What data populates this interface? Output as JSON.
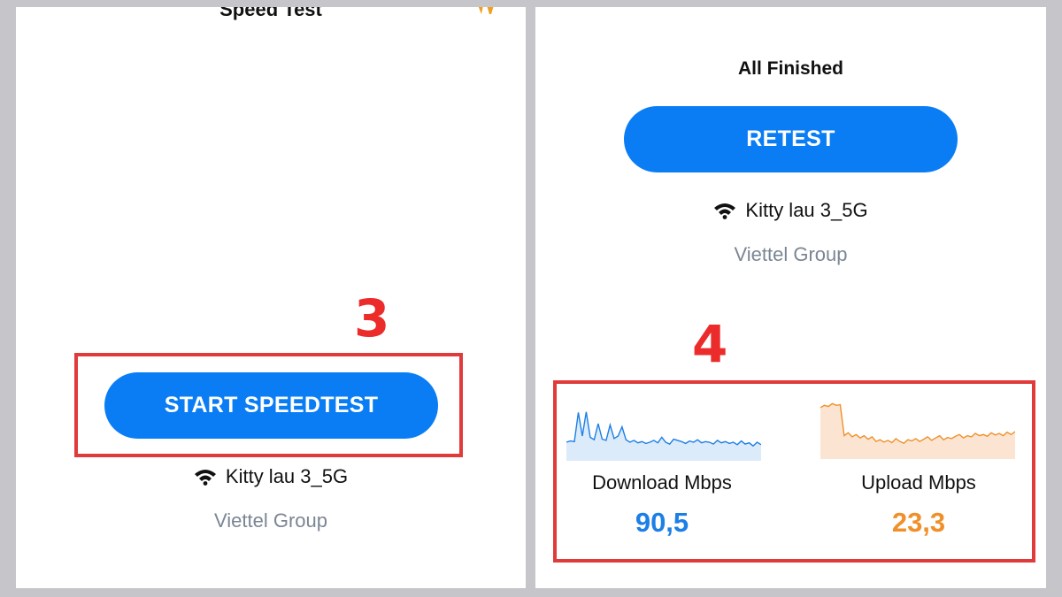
{
  "left": {
    "header_title": "Speed Test",
    "step_number": "3",
    "start_button": "START SPEEDTEST",
    "network_name": "Kitty lau 3_5G",
    "isp": "Viettel Group"
  },
  "right": {
    "status": "All Finished",
    "retest_button": "RETEST",
    "network_name": "Kitty lau 3_5G",
    "isp": "Viettel Group",
    "step_number": "4",
    "download": {
      "label": "Download Mbps",
      "value": "90,5",
      "color": "#1c7fe6",
      "samples": [
        30,
        32,
        31,
        78,
        40,
        79,
        38,
        34,
        60,
        35,
        33,
        58,
        36,
        40,
        55,
        34,
        30,
        33,
        29,
        31,
        28,
        30,
        33,
        29,
        38,
        30,
        27,
        35,
        33,
        31,
        28,
        32,
        30,
        34,
        29,
        31,
        30,
        27,
        33,
        29,
        31,
        28,
        30,
        26,
        32,
        27,
        29,
        24,
        30,
        26
      ]
    },
    "upload": {
      "label": "Upload Mbps",
      "value": "23,3",
      "color": "#f0902a",
      "samples": [
        88,
        92,
        90,
        95,
        92,
        93,
        40,
        45,
        38,
        42,
        36,
        40,
        34,
        38,
        30,
        33,
        29,
        32,
        28,
        35,
        30,
        27,
        33,
        31,
        35,
        30,
        34,
        38,
        32,
        36,
        40,
        33,
        37,
        35,
        39,
        42,
        36,
        40,
        38,
        44,
        40,
        42,
        39,
        45,
        41,
        44,
        40,
        46,
        42,
        47
      ]
    }
  }
}
